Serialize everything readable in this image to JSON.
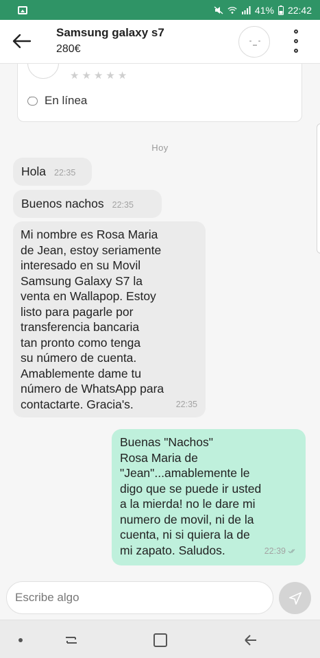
{
  "status_bar": {
    "battery": "41%",
    "time": "22:42",
    "icons": [
      "gallery-icon",
      "mute-icon",
      "wifi-icon",
      "signal-icon",
      "battery-icon"
    ]
  },
  "header": {
    "title": "Samsung galaxy s7",
    "price": "280€",
    "back_icon": "arrow-left-icon",
    "more_icon": "vertical-dots-icon"
  },
  "profile_card": {
    "rating_stars": 5,
    "online_label": "En línea"
  },
  "conversation": {
    "day_label": "Hoy",
    "messages": [
      {
        "direction": "in",
        "text": "Hola",
        "time": "22:35"
      },
      {
        "direction": "in",
        "text": "Buenos nachos",
        "time": "22:35"
      },
      {
        "direction": "in",
        "text": "Mi nombre es Rosa Maria\nde Jean, estoy seriamente\ninteresado en su Movil\nSamsung Galaxy S7 la\nventa en Wallapop. Estoy\nlisto para pagarle por\ntransferencia bancaria\ntan pronto como tenga\nsu número de cuenta.\nAmablemente dame tu\nnúmero de WhatsApp para\ncontactarte. Gracia's.",
        "time": "22:35"
      },
      {
        "direction": "out",
        "text": "Buenas \"Nachos\"\nRosa Maria de\n\"Jean\"...amablemente le\ndigo que se puede ir usted\na la mierda! no le dare mi\nnumero de movil, ni de la\ncuenta, ni si quiera la de\nmi zapato. Saludos.",
        "time": "22:39",
        "status": "read"
      }
    ]
  },
  "composer": {
    "placeholder": "Escribe algo",
    "send_icon": "send-icon"
  },
  "colors": {
    "status_bar": "#2f9466",
    "outgoing_bubble": "#bff0dc",
    "incoming_bubble": "#ebebeb"
  }
}
